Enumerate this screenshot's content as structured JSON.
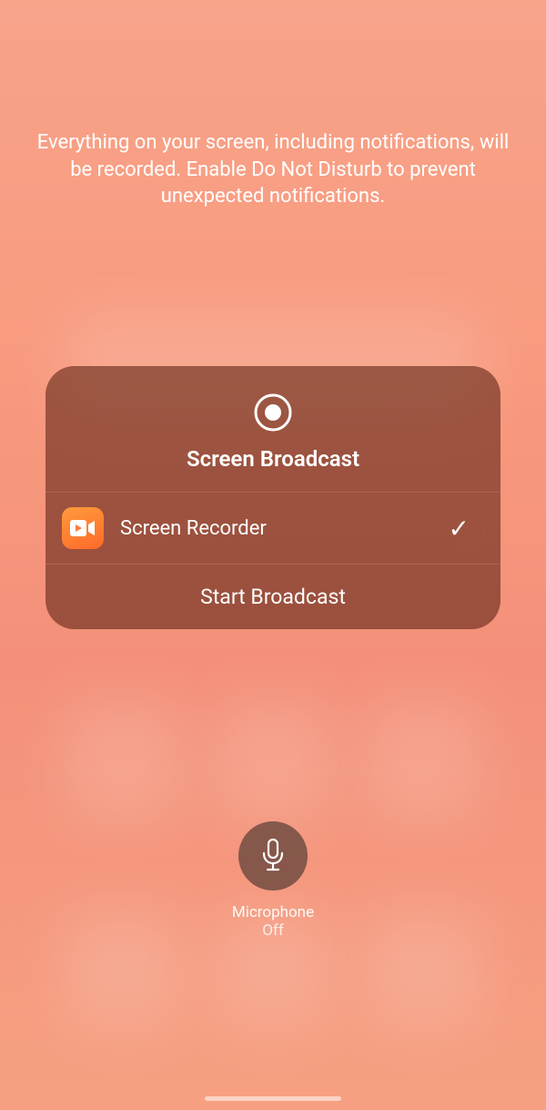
{
  "description": "Everything on your screen, including notifications, will be recorded. Enable Do Not Disturb to prevent unexpected notifications.",
  "panel": {
    "title": "Screen Broadcast",
    "item": {
      "label": "Screen Recorder",
      "selected_glyph": "✓"
    },
    "action_label": "Start Broadcast"
  },
  "microphone": {
    "label": "Microphone",
    "state": "Off"
  }
}
